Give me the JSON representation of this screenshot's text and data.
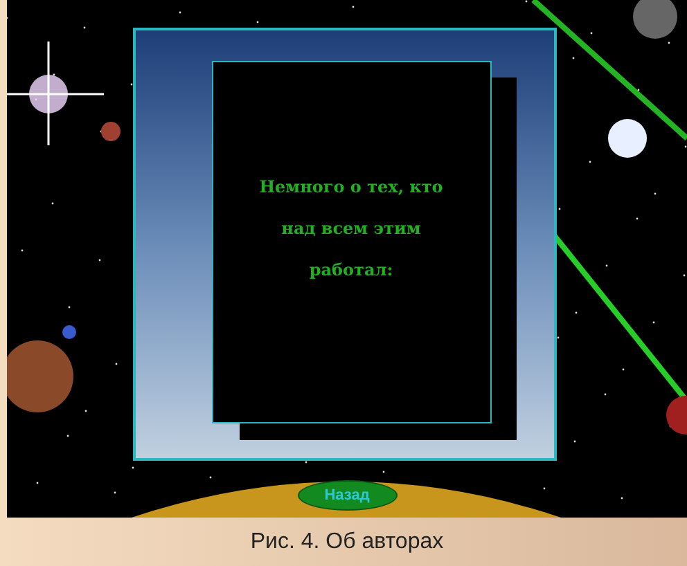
{
  "screen": {
    "message": "Немного о тех, кто над всем этим работал:",
    "back_button": "Назад"
  },
  "caption": "Рис. 4. Об авторах"
}
